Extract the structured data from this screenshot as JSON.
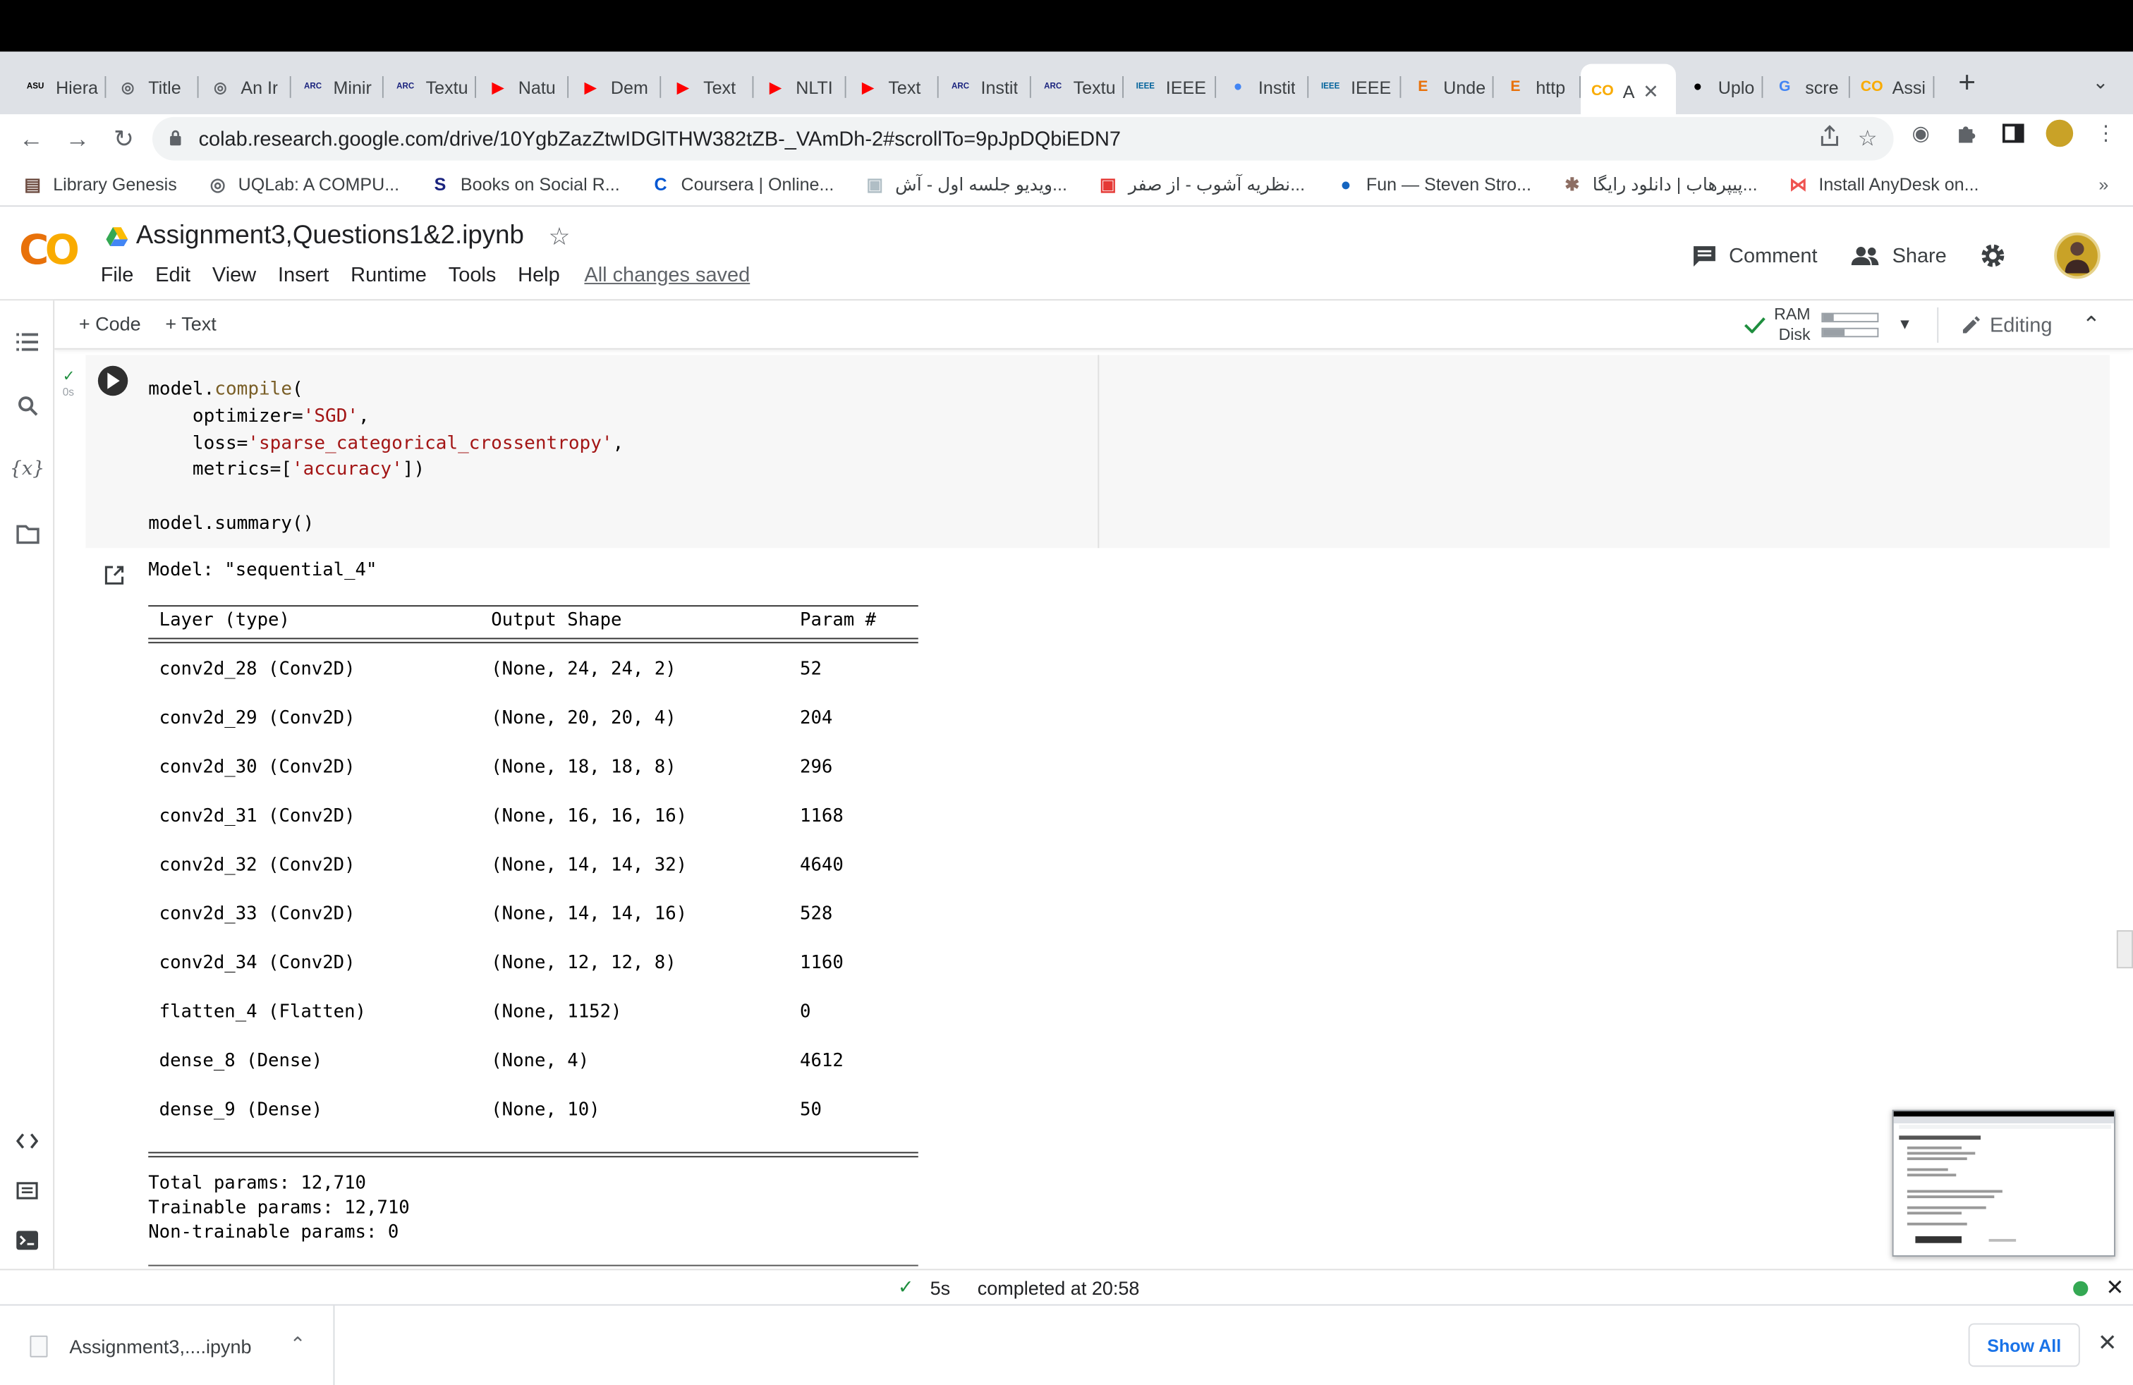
{
  "browser": {
    "tabs": [
      {
        "title": "Hiera",
        "icon": "asu-icon",
        "color": "#000000"
      },
      {
        "title": "Title",
        "icon": "globe-icon",
        "color": "#5f6368"
      },
      {
        "title": "An Ir",
        "icon": "globe-icon",
        "color": "#5f6368"
      },
      {
        "title": "Minir",
        "icon": "arc-icon",
        "color": "#1a237e"
      },
      {
        "title": "Textu",
        "icon": "arc-icon",
        "color": "#1a237e"
      },
      {
        "title": "Natu",
        "icon": "youtube-icon",
        "color": "#ff0000"
      },
      {
        "title": "Dem",
        "icon": "youtube-icon",
        "color": "#ff0000"
      },
      {
        "title": "Text",
        "icon": "youtube-icon",
        "color": "#ff0000"
      },
      {
        "title": "NLTI",
        "icon": "youtube-icon",
        "color": "#ff0000"
      },
      {
        "title": "Text",
        "icon": "youtube-icon",
        "color": "#ff0000"
      },
      {
        "title": "Instit",
        "icon": "arc-icon",
        "color": "#1a237e"
      },
      {
        "title": "Textu",
        "icon": "arc-icon",
        "color": "#1a237e"
      },
      {
        "title": "IEEE",
        "icon": "ieee-icon",
        "color": "#00629b"
      },
      {
        "title": "Instit",
        "icon": "chrome-icon",
        "color": "#4285f4"
      },
      {
        "title": "IEEE",
        "icon": "ieee-icon",
        "color": "#00629b"
      },
      {
        "title": "Unde",
        "icon": "e-icon",
        "color": "#e8710a"
      },
      {
        "title": "http",
        "icon": "e-icon",
        "color": "#e8710a"
      },
      {
        "title": "A",
        "icon": "colab-icon",
        "color": "#f9ab00",
        "active": true
      },
      {
        "title": "Uplo",
        "icon": "github-icon",
        "color": "#000000"
      },
      {
        "title": "scre",
        "icon": "google-icon",
        "color": "#4285f4"
      },
      {
        "title": "Assi",
        "icon": "colab-icon",
        "color": "#f9ab00"
      }
    ],
    "url": "colab.research.google.com/drive/10YgbZazZtwIDGlTHW382tZB-_VAmDh-2#scrollTo=9pJpDQbiEDN7",
    "bookmarks": [
      {
        "label": "Library Genesis",
        "icon": "book-icon",
        "color": "#6d4c41"
      },
      {
        "label": "UQLab: A COMPU...",
        "icon": "globe-icon",
        "color": "#5f6368"
      },
      {
        "label": "Books on Social R...",
        "icon": "s-icon",
        "color": "#1a237e"
      },
      {
        "label": "Coursera | Online...",
        "icon": "coursera-icon",
        "color": "#0056d2"
      },
      {
        "label": "ویدیو جلسه اول - آش...",
        "icon": "image-icon",
        "color": "#b0bec5"
      },
      {
        "label": "نظریه آشوب - از صفر...",
        "icon": "image-icon",
        "color": "#e53935"
      },
      {
        "label": "Fun — Steven Stro...",
        "icon": "circle-icon",
        "color": "#1565c0"
      },
      {
        "label": "پیپرهاب | دانلود رایگا...",
        "icon": "seal-icon",
        "color": "#8d6e63"
      },
      {
        "label": "Install AnyDesk on...",
        "icon": "bow-icon",
        "color": "#ef5350"
      }
    ]
  },
  "colab": {
    "notebook_title": "Assignment3,Questions1&2.ipynb",
    "menu": [
      "File",
      "Edit",
      "View",
      "Insert",
      "Runtime",
      "Tools",
      "Help"
    ],
    "save_status": "All changes saved",
    "comment_label": "Comment",
    "share_label": "Share",
    "add_code_label": "+ Code",
    "add_text_label": "+ Text",
    "ram_label": "RAM",
    "disk_label": "Disk",
    "ram_usage": 0.2,
    "disk_usage": 0.4,
    "editing_label": "Editing",
    "exec_time": "0s"
  },
  "cell": {
    "code_lines": [
      [
        {
          "t": "model."
        },
        {
          "t": "compile",
          "c": "fn"
        },
        {
          "t": "("
        }
      ],
      [
        {
          "t": "    optimizer="
        },
        {
          "t": "'SGD'",
          "c": "str"
        },
        {
          "t": ","
        }
      ],
      [
        {
          "t": "    loss="
        },
        {
          "t": "'sparse_categorical_crossentropy'",
          "c": "str"
        },
        {
          "t": ","
        }
      ],
      [
        {
          "t": "    metrics=["
        },
        {
          "t": "'accuracy'",
          "c": "str"
        },
        {
          "t": "])"
        }
      ],
      [
        {
          "t": ""
        }
      ],
      [
        {
          "t": "model.summary()"
        }
      ]
    ]
  },
  "output": {
    "model_line": "Model: \"sequential_4\"",
    "headers": [
      "Layer (type)",
      "Output Shape",
      "Param #"
    ],
    "rows": [
      [
        "conv2d_28 (Conv2D)",
        "(None, 24, 24, 2)",
        "52"
      ],
      [
        "conv2d_29 (Conv2D)",
        "(None, 20, 20, 4)",
        "204"
      ],
      [
        "conv2d_30 (Conv2D)",
        "(None, 18, 18, 8)",
        "296"
      ],
      [
        "conv2d_31 (Conv2D)",
        "(None, 16, 16, 16)",
        "1168"
      ],
      [
        "conv2d_32 (Conv2D)",
        "(None, 14, 14, 32)",
        "4640"
      ],
      [
        "conv2d_33 (Conv2D)",
        "(None, 14, 14, 16)",
        "528"
      ],
      [
        "conv2d_34 (Conv2D)",
        "(None, 12, 12, 8)",
        "1160"
      ],
      [
        "flatten_4 (Flatten)",
        "(None, 1152)",
        "0"
      ],
      [
        "dense_8 (Dense)",
        "(None, 4)",
        "4612"
      ],
      [
        "dense_9 (Dense)",
        "(None, 10)",
        "50"
      ]
    ],
    "total_params": "Total params: 12,710",
    "trainable_params": "Trainable params: 12,710",
    "non_trainable_params": "Non-trainable params: 0"
  },
  "status": {
    "duration": "5s",
    "completed": "completed at 20:58"
  },
  "downloads": {
    "file_name": "Assignment3,....ipynb",
    "show_all_label": "Show All"
  },
  "colors": {
    "accent_green": "#1e8e3e",
    "colab_orange": "#f9ab00",
    "string_red": "#a31515",
    "link_blue": "#1a73e8"
  }
}
